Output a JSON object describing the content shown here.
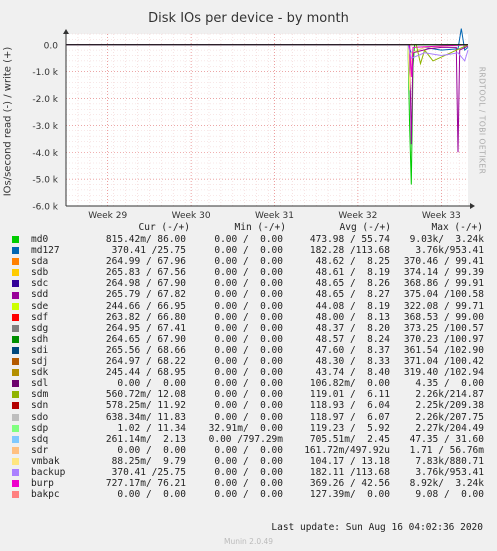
{
  "title": "Disk IOs per device - by month",
  "y_axis_label": "IOs/second read (-) / write (+)",
  "side_label": "RRDTOOL / TOBI OETIKER",
  "columns": [
    "Cur (-/+)",
    "Min (-/+)",
    "Avg (-/+)",
    "Max (-/+)"
  ],
  "legend": [
    {
      "name": "md0",
      "color": "#00cc00",
      "cur": "815.42m/ 86.00",
      "min": "0.00 /  0.00",
      "avg": "473.98 / 55.74",
      "max": "9.03k/  3.24k"
    },
    {
      "name": "md127",
      "color": "#0066b3",
      "cur": "370.41 /25.75",
      "min": "0.00 /  0.00",
      "avg": "182.28 /113.68",
      "max": "3.76k/953.41"
    },
    {
      "name": "sda",
      "color": "#ff8000",
      "cur": "264.99 / 67.96",
      "min": "0.00 /  0.00",
      "avg": "48.62 /  8.25",
      "max": "370.46 / 99.41"
    },
    {
      "name": "sdb",
      "color": "#ffcc00",
      "cur": "265.83 / 67.56",
      "min": "0.00 /  0.00",
      "avg": "48.61 /  8.19",
      "max": "374.14 / 99.39"
    },
    {
      "name": "sdc",
      "color": "#330099",
      "cur": "264.98 / 67.90",
      "min": "0.00 /  0.00",
      "avg": "48.65 /  8.26",
      "max": "368.86 / 99.91"
    },
    {
      "name": "sdd",
      "color": "#990099",
      "cur": "265.79 / 67.82",
      "min": "0.00 /  0.00",
      "avg": "48.65 /  8.27",
      "max": "375.04 /100.58"
    },
    {
      "name": "sde",
      "color": "#ccff00",
      "cur": "244.66 / 66.95",
      "min": "0.00 /  0.00",
      "avg": "44.08 /  8.19",
      "max": "322.08 / 99.71"
    },
    {
      "name": "sdf",
      "color": "#ff0000",
      "cur": "263.82 / 66.80",
      "min": "0.00 /  0.00",
      "avg": "48.00 /  8.13",
      "max": "368.53 / 99.00"
    },
    {
      "name": "sdg",
      "color": "#808080",
      "cur": "264.95 / 67.41",
      "min": "0.00 /  0.00",
      "avg": "48.37 /  8.20",
      "max": "373.25 /100.57"
    },
    {
      "name": "sdh",
      "color": "#008f00",
      "cur": "264.65 / 67.90",
      "min": "0.00 /  0.00",
      "avg": "48.57 /  8.24",
      "max": "370.23 /100.97"
    },
    {
      "name": "sdi",
      "color": "#00487d",
      "cur": "265.56 / 68.66",
      "min": "0.00 /  0.00",
      "avg": "47.60 /  8.37",
      "max": "361.54 /102.90"
    },
    {
      "name": "sdj",
      "color": "#b35a00",
      "cur": "264.97 / 68.22",
      "min": "0.00 /  0.00",
      "avg": "48.30 /  8.33",
      "max": "371.04 /100.42"
    },
    {
      "name": "sdk",
      "color": "#b38f00",
      "cur": "245.44 / 68.95",
      "min": "0.00 /  0.00",
      "avg": "43.74 /  8.40",
      "max": "319.40 /102.94"
    },
    {
      "name": "sdl",
      "color": "#6b006b",
      "cur": "0.00 /  0.00",
      "min": "0.00 /  0.00",
      "avg": "106.82m/  0.00",
      "max": "4.35 /  0.00"
    },
    {
      "name": "sdm",
      "color": "#8fb300",
      "cur": "560.72m/ 12.08",
      "min": "0.00 /  0.00",
      "avg": "119.01 /  6.11",
      "max": "2.26k/214.87"
    },
    {
      "name": "sdn",
      "color": "#b30000",
      "cur": "578.25m/ 11.92",
      "min": "0.00 /  0.00",
      "avg": "118.93 /  6.04",
      "max": "2.25k/209.38"
    },
    {
      "name": "sdo",
      "color": "#bebebe",
      "cur": "638.34m/ 11.83",
      "min": "0.00 /  0.00",
      "avg": "118.97 /  6.07",
      "max": "2.26k/207.75"
    },
    {
      "name": "sdp",
      "color": "#80ff80",
      "cur": "1.02 / 11.34",
      "min": "32.91m/  0.00",
      "avg": "119.23 /  5.92",
      "max": "2.27k/204.49"
    },
    {
      "name": "sdq",
      "color": "#80c9ff",
      "cur": "261.14m/  2.13",
      "min": "0.00 /797.29m",
      "avg": "705.51m/  2.45",
      "max": "47.35 / 31.60"
    },
    {
      "name": "sdr",
      "color": "#ffc080",
      "cur": "0.00 /  0.00",
      "min": "0.00 /  0.00",
      "avg": "161.72m/497.92u",
      "max": "1.71 / 56.76m"
    },
    {
      "name": "vmbak",
      "color": "#ffe680",
      "cur": "88.25m/  9.79",
      "min": "0.00 /  0.00",
      "avg": "104.17 / 13.18",
      "max": "7.83k/880.71"
    },
    {
      "name": "backup",
      "color": "#aa80ff",
      "cur": "370.41 /25.75",
      "min": "0.00 /  0.00",
      "avg": "182.11 /113.68",
      "max": "3.76k/953.41"
    },
    {
      "name": "burp",
      "color": "#ee00cc",
      "cur": "727.17m/ 76.21",
      "min": "0.00 /  0.00",
      "avg": "369.26 / 42.56",
      "max": "8.92k/  3.24k"
    },
    {
      "name": "bakpc",
      "color": "#ff8080",
      "cur": "0.00 /  0.00",
      "min": "0.00 /  0.00",
      "avg": "127.39m/  0.00",
      "max": "9.08 /  0.00"
    }
  ],
  "last_update": "Last update: Sun Aug 16 04:02:36 2020",
  "footer": "Munin 2.0.49",
  "chart_data": {
    "type": "line",
    "title": "Disk IOs per device - by month",
    "ylabel": "IOs/second read (-) / write (+)",
    "ylim": [
      -6000,
      400
    ],
    "y_ticks": [
      0,
      -1000,
      -2000,
      -3000,
      -4000,
      -5000,
      -6000
    ],
    "y_tick_labels": [
      "0.0",
      "-1.0 k",
      "-2.0 k",
      "-3.0 k",
      "-4.0 k",
      "-5.0 k",
      "-6.0 k"
    ],
    "x_ticks": [
      "Week 29",
      "Week 30",
      "Week 31",
      "Week 32",
      "Week 33"
    ],
    "x_tick_positions": [
      0.5,
      1.5,
      2.5,
      3.5,
      4.5
    ],
    "xlim": [
      0,
      4.82
    ],
    "grid": true,
    "series": [
      {
        "name": "md0",
        "color": "#00cc00",
        "x": [
          0,
          4.1,
          4.12,
          4.14,
          4.16,
          4.18,
          4.3,
          4.5,
          4.7,
          4.82
        ],
        "y": [
          0,
          0,
          -3000,
          -5200,
          -800,
          0,
          0,
          0,
          0,
          0
        ]
      },
      {
        "name": "md127",
        "color": "#0066b3",
        "x": [
          0,
          4.1,
          4.14,
          4.3,
          4.5,
          4.7,
          4.74,
          4.78,
          4.82
        ],
        "y": [
          0,
          0,
          -300,
          -100,
          -200,
          -150,
          600,
          -200,
          -100
        ]
      },
      {
        "name": "sdd",
        "color": "#990099",
        "x": [
          0,
          4.12,
          4.14,
          4.16,
          4.35,
          4.5,
          4.68,
          4.7,
          4.72,
          4.82
        ],
        "y": [
          0,
          0,
          -3700,
          -300,
          -150,
          -100,
          -100,
          -4000,
          -200,
          -50
        ]
      },
      {
        "name": "vmbak",
        "color": "#ffe680",
        "x": [
          0,
          4.1,
          4.12,
          4.14,
          4.3,
          4.82
        ],
        "y": [
          0,
          0,
          -1700,
          -300,
          -100,
          0
        ]
      },
      {
        "name": "burp",
        "color": "#ee00cc",
        "x": [
          0,
          4.12,
          4.14,
          4.16,
          4.82
        ],
        "y": [
          0,
          0,
          -1200,
          -100,
          0
        ]
      },
      {
        "name": "sdm",
        "color": "#8fb300",
        "x": [
          0,
          4.2,
          4.25,
          4.3,
          4.4,
          4.82
        ],
        "y": [
          0,
          0,
          -700,
          -200,
          -600,
          0
        ]
      },
      {
        "name": "backup",
        "color": "#aa80ff",
        "x": [
          0,
          4.1,
          4.14,
          4.3,
          4.5,
          4.6,
          4.7,
          4.78,
          4.82
        ],
        "y": [
          0,
          0,
          -500,
          -300,
          -400,
          -350,
          -300,
          -600,
          -200
        ]
      }
    ]
  }
}
